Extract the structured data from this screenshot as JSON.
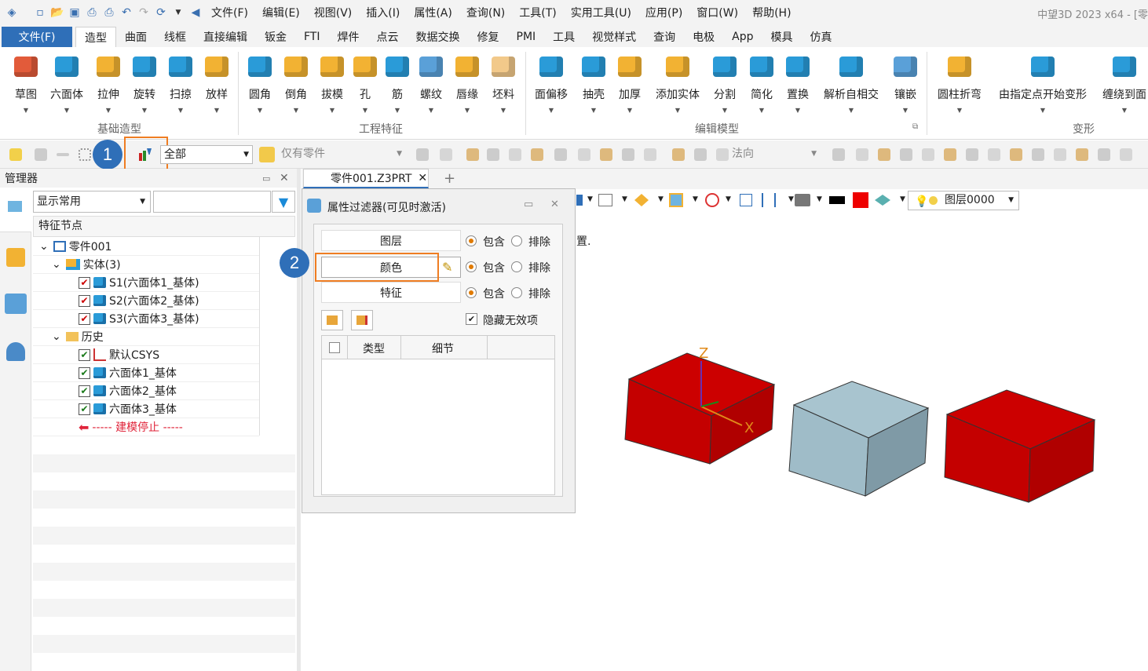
{
  "menubar": {
    "items": [
      "文件(F)",
      "编辑(E)",
      "视图(V)",
      "插入(I)",
      "属性(A)",
      "查询(N)",
      "工具(T)",
      "实用工具(U)",
      "应用(P)",
      "窗口(W)",
      "帮助(H)"
    ],
    "app_title": "中望3D 2023 x64 - [零"
  },
  "ribbon_tabs": {
    "file": "文件(F)",
    "tabs": [
      "造型",
      "曲面",
      "线框",
      "直接编辑",
      "钣金",
      "FTI",
      "焊件",
      "点云",
      "数据交换",
      "修复",
      "PMI",
      "工具",
      "视觉样式",
      "查询",
      "电极",
      "App",
      "模具",
      "仿真"
    ],
    "active": "造型"
  },
  "ribbon": {
    "tools": [
      "草图",
      "六面体",
      "拉伸",
      "旋转",
      "扫掠",
      "放样",
      "圆角",
      "倒角",
      "拔模",
      "孔",
      "筋",
      "螺纹",
      "唇缘",
      "坯料",
      "面偏移",
      "抽壳",
      "加厚",
      "添加实体",
      "分割",
      "简化",
      "置换",
      "解析自相交",
      "镶嵌",
      "圆柱折弯",
      "由指定点开始变形",
      "缠绕到面"
    ],
    "groups": [
      "基础造型",
      "工程特征",
      "编辑模型",
      "变形"
    ]
  },
  "toolbar": {
    "filter_value": "全部",
    "scope_value": "仅有零件",
    "view_value": "法向"
  },
  "manager": {
    "title": "管理器",
    "display_select": "显示常用",
    "column_header": "特征节点",
    "nodes": [
      "零件001",
      "实体(3)",
      "S1(六面体1_基体)",
      "S2(六面体2_基体)",
      "S3(六面体3_基体)",
      "历史",
      "默认CSYS",
      "六面体1_基体",
      "六面体2_基体",
      "六面体3_基体",
      "----- 建模停止 -----"
    ]
  },
  "doc_tab": {
    "label": "零件001.Z3PRT"
  },
  "dialog": {
    "title": "属性过滤器(可见时激活)",
    "filters": [
      "图层",
      "颜色",
      "特征"
    ],
    "include": "包含",
    "exclude": "排除",
    "hide_invalid": "隐藏无效项",
    "columns": [
      "类型",
      "细节"
    ]
  },
  "viewbar": {
    "layer": "图层0000",
    "trailing_text": "置."
  },
  "badges": [
    "1",
    "2"
  ],
  "axes": {
    "z": "Z",
    "x": "X"
  },
  "colors": {
    "accent": "#2f6fb8",
    "highlight": "#ef7d22",
    "red_box": "#cc0000",
    "gray_box": "#9fbcc8"
  }
}
